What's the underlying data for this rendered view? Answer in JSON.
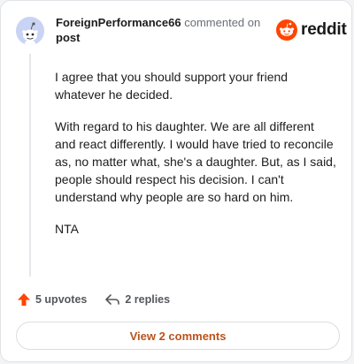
{
  "comment": {
    "username": "ForeignPerformance66",
    "meta_text": "commented on",
    "post_link_text": "post",
    "brand": "reddit",
    "body_paragraphs": [
      "I agree that you should support your friend whatever he decided.",
      "With regard to his daughter. We are all different and react differently. I would have tried to reconcile as, no matter what, she's a daughter. But, as I said, people should respect his decision. I can't understand why people are so hard on him.",
      "NTA"
    ]
  },
  "actions": {
    "upvotes_label": "5 upvotes",
    "replies_label": "2 replies"
  },
  "footer": {
    "view_comments_label": "View 2 comments"
  },
  "icons": {
    "avatar": "snoo-avatar-icon",
    "logo": "reddit-logo-icon",
    "upvote": "upvote-arrow-icon",
    "reply": "reply-arrow-icon"
  },
  "colors": {
    "brand_orange": "#ff4500",
    "accent_link": "#b9541c",
    "upvote_orange": "#ff4500"
  }
}
